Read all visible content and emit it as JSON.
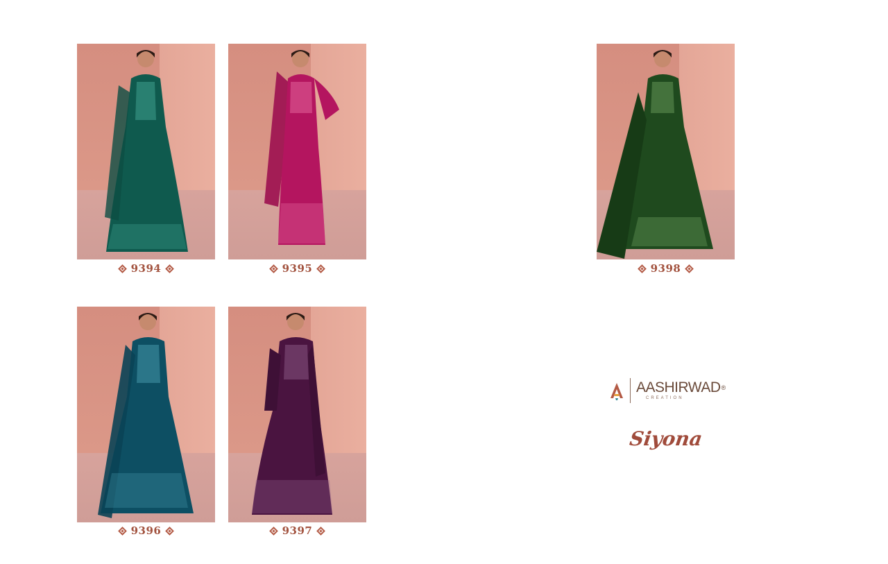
{
  "catalog": {
    "items": [
      {
        "code": "9394",
        "dress_color": "#0f5a4e",
        "accent": "#3fa08e"
      },
      {
        "code": "9395",
        "dress_color": "#b4155f",
        "accent": "#e56aa0"
      },
      {
        "code": "9398",
        "dress_color": "#1f4a1e",
        "accent": "#6a9a5a"
      },
      {
        "code": "9396",
        "dress_color": "#0d4f63",
        "accent": "#4a9db0"
      },
      {
        "code": "9397",
        "dress_color": "#4a1440",
        "accent": "#8b5a86"
      }
    ]
  },
  "brand": {
    "name": "AASHIRWAD",
    "registered": "®",
    "subtitle": "CREATION",
    "collection": "Siyona",
    "colors": {
      "text": "#6a4a3a",
      "accent": "#a04b3b"
    }
  }
}
